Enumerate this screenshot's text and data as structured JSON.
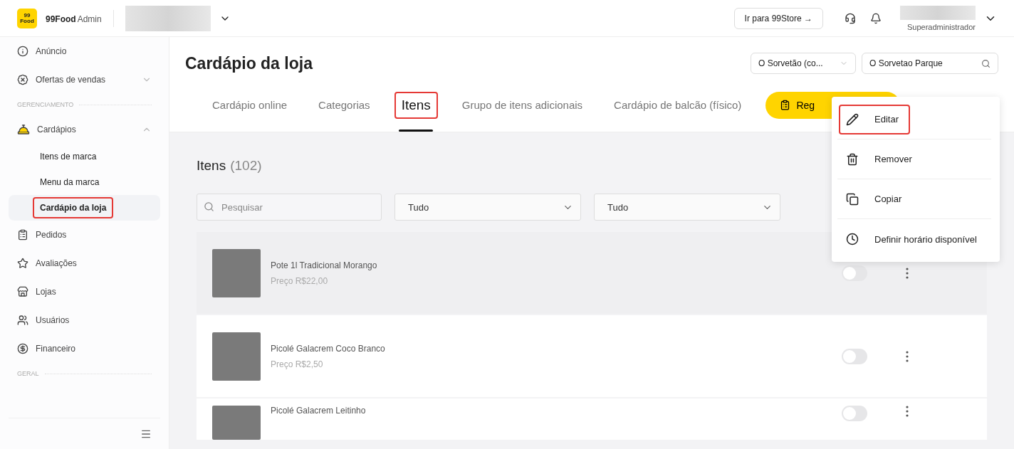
{
  "header": {
    "logo_mark": [
      "99",
      "Food"
    ],
    "brand": "99Food",
    "brand_suffix": "Admin",
    "store_button": "Ir para 99Store →",
    "user_role": "Superadministrador"
  },
  "sidebar": {
    "items": [
      {
        "kind": "link",
        "label": "Anúncio"
      },
      {
        "kind": "link",
        "label": "Ofertas de vendas",
        "expandable": true
      },
      {
        "kind": "section",
        "label": "GERENCIAMENTO"
      },
      {
        "kind": "group",
        "label": "Cardápios",
        "expanded": true,
        "children": [
          {
            "label": "Itens de marca",
            "selected": false,
            "highlighted": false
          },
          {
            "label": "Menu da marca",
            "selected": false,
            "highlighted": false
          },
          {
            "label": "Cardápio da loja",
            "selected": true,
            "highlighted": true
          }
        ]
      },
      {
        "kind": "link",
        "label": "Pedidos"
      },
      {
        "kind": "link",
        "label": "Avaliações"
      },
      {
        "kind": "link",
        "label": "Lojas"
      },
      {
        "kind": "link",
        "label": "Usuários"
      },
      {
        "kind": "link",
        "label": "Financeiro"
      },
      {
        "kind": "section",
        "label": "GERAL"
      }
    ]
  },
  "page": {
    "title": "Cardápio da loja",
    "store_select": "O Sorvetão (co...",
    "store_search": "O Sorvetao Parque"
  },
  "tabs": [
    {
      "label": "Cardápio online",
      "selected": false,
      "highlighted": false
    },
    {
      "label": "Categorias",
      "selected": false,
      "highlighted": false
    },
    {
      "label": "Itens",
      "selected": true,
      "highlighted": true
    },
    {
      "label": "Grupo de itens adicionais",
      "selected": false,
      "highlighted": false
    },
    {
      "label": "Cardápio de balcão (físico)",
      "selected": false,
      "highlighted": false
    }
  ],
  "action_button": "Reg",
  "items_section": {
    "heading": "Itens",
    "count": "(102)",
    "search": {
      "placeholder": "Pesquisar"
    },
    "filters": [
      "Tudo",
      "Tudo"
    ]
  },
  "items": [
    {
      "name": "Pote 1l Tradicional Morango",
      "price": "Preço R$22,00",
      "on": false,
      "hovered": true
    },
    {
      "name": "Picolé Galacrem Coco Branco",
      "price": "Preço R$2,50",
      "on": false,
      "hovered": false
    },
    {
      "name": "Picolé Galacrem Leitinho",
      "on": false,
      "hovered": false
    }
  ],
  "context_menu": [
    {
      "label": "Editar",
      "highlighted": true
    },
    {
      "label": "Remover",
      "highlighted": false
    },
    {
      "label": "Copiar",
      "highlighted": false
    },
    {
      "label": "Definir horário disponível",
      "highlighted": false
    }
  ]
}
